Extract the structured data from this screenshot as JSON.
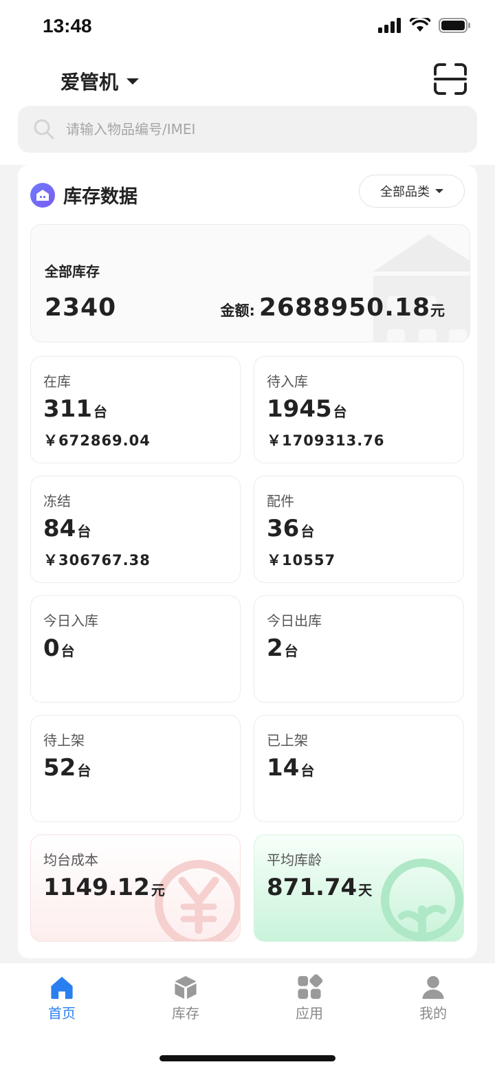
{
  "status_bar": {
    "time": "13:48"
  },
  "header": {
    "app_title": "爱管机",
    "search_placeholder": "请输入物品编号/IMEI"
  },
  "inventory": {
    "section_title": "库存数据",
    "filter_label": "全部品类",
    "total_label": "全部库存",
    "total_value": "2340",
    "amount_label": "金额:",
    "amount_value": "2688950.18",
    "amount_unit": "元"
  },
  "stats": [
    {
      "label": "在库",
      "num": "311",
      "unit": "台",
      "money": "￥672869.04"
    },
    {
      "label": "待入库",
      "num": "1945",
      "unit": "台",
      "money": "￥1709313.76"
    },
    {
      "label": "冻结",
      "num": "84",
      "unit": "台",
      "money": "￥306767.38"
    },
    {
      "label": "配件",
      "num": "36",
      "unit": "台",
      "money": "￥10557"
    },
    {
      "label": "今日入库",
      "num": "0",
      "unit": "台"
    },
    {
      "label": "今日出库",
      "num": "2",
      "unit": "台"
    },
    {
      "label": "待上架",
      "num": "52",
      "unit": "台"
    },
    {
      "label": "已上架",
      "num": "14",
      "unit": "台"
    },
    {
      "label": "均台成本",
      "num": "1149.12",
      "unit": "元"
    },
    {
      "label": "平均库龄",
      "num": "871.74",
      "unit": "天"
    }
  ],
  "tabs": [
    {
      "label": "首页",
      "icon": "home-icon",
      "active": true
    },
    {
      "label": "库存",
      "icon": "box-icon"
    },
    {
      "label": "应用",
      "icon": "apps-icon"
    },
    {
      "label": "我的",
      "icon": "user-icon"
    }
  ],
  "colors": {
    "accent": "#2a7ff0",
    "badge": "#6d7bff",
    "pink_bg": "#fdeeee",
    "green_bg": "#c9f3da"
  }
}
